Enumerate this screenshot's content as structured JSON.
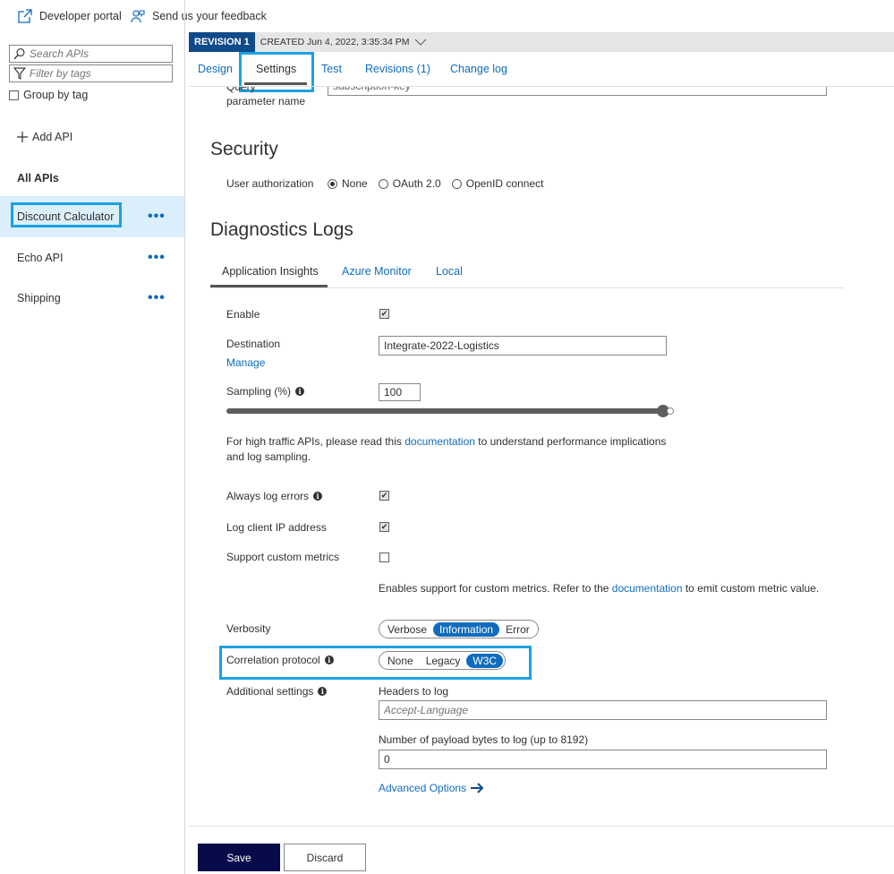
{
  "topbar": {
    "developer_portal": "Developer portal",
    "feedback": "Send us your feedback"
  },
  "sidebar": {
    "search_placeholder": "Search APIs",
    "filter_placeholder": "Filter by tags",
    "group_by_tag": "Group by tag",
    "add_api": "Add API",
    "all_apis": "All APIs",
    "apis": [
      {
        "label": "Discount Calculator",
        "selected": true
      },
      {
        "label": "Echo API",
        "selected": false
      },
      {
        "label": "Shipping",
        "selected": false
      }
    ],
    "more_glyph": "•••"
  },
  "revision": {
    "badge": "REVISION 1",
    "created": "CREATED Jun 4, 2022, 3:35:34 PM"
  },
  "tabs": [
    "Design",
    "Settings",
    "Test",
    "Revisions (1)",
    "Change log"
  ],
  "active_tab": "Settings",
  "query_param": {
    "label": "Query parameter name",
    "value": "subscription-key"
  },
  "security": {
    "heading": "Security",
    "user_authorization_label": "User authorization",
    "options": [
      "None",
      "OAuth 2.0",
      "OpenID connect"
    ],
    "selected": "None"
  },
  "diagnostics": {
    "heading": "Diagnostics Logs",
    "subtabs": [
      "Application Insights",
      "Azure Monitor",
      "Local"
    ],
    "active_subtab": "Application Insights",
    "enable_label": "Enable",
    "enable_checked": true,
    "destination_label": "Destination",
    "destination_value": "Integrate-2022-Logistics",
    "manage_link": "Manage",
    "sampling_label": "Sampling (%)",
    "sampling_value": "100",
    "sampling_fraction": 1.0,
    "note_prefix": "For high traffic APIs, please read this ",
    "note_link": "documentation",
    "note_suffix": " to understand performance implications",
    "note_line2": "and log sampling.",
    "always_log_errors_label": "Always log errors",
    "always_log_errors_checked": true,
    "log_client_ip_label": "Log client IP address",
    "log_client_ip_checked": true,
    "custom_metrics_label": "Support custom metrics",
    "custom_metrics_checked": false,
    "metrics_note_prefix": "Enables support for custom metrics. Refer to the ",
    "metrics_note_link": "documentation",
    "metrics_note_suffix": " to emit custom metric value.",
    "verbosity_label": "Verbosity",
    "verbosity_options": [
      "Verbose",
      "Information",
      "Error"
    ],
    "verbosity_selected": "Information",
    "correlation_label": "Correlation protocol",
    "correlation_options": [
      "None",
      "Legacy",
      "W3C"
    ],
    "correlation_selected": "W3C",
    "additional_label": "Additional settings",
    "headers_label": "Headers to log",
    "headers_placeholder": "Accept-Language",
    "payload_label": "Number of payload bytes to log (up to 8192)",
    "payload_value": "0",
    "advanced_options": "Advanced Options"
  },
  "footer": {
    "save": "Save",
    "discard": "Discard"
  },
  "colors": {
    "accent": "#0f6cbd",
    "highlight": "#1ba1e2",
    "save_bg": "#080b4a",
    "revision_badge": "#0f4a8a"
  },
  "icons": [
    "external-link-icon",
    "feedback-icon",
    "search-icon",
    "filter-icon",
    "plus-icon",
    "info-icon",
    "arrow-right-icon",
    "chevron-down-icon"
  ]
}
